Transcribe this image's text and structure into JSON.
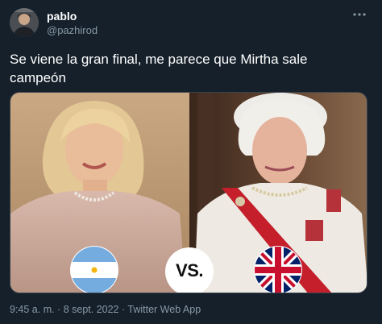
{
  "tweet": {
    "display_name": "pablo",
    "handle": "@pazhirod",
    "more_icon": "ellipsis-icon",
    "text": "Se viene la gran final, me parece que Mirtha sale campeón",
    "timestamp": "9:45 a. m. · 8 sept. 2022 · Twitter Web App"
  },
  "media": {
    "vs_label": "VS.",
    "left_flag": "argentina-flag",
    "right_flag": "united-kingdom-flag"
  },
  "colors": {
    "background": "#15202b",
    "text_primary": "#ffffff",
    "text_secondary": "#8899a6",
    "border": "#38444d"
  }
}
